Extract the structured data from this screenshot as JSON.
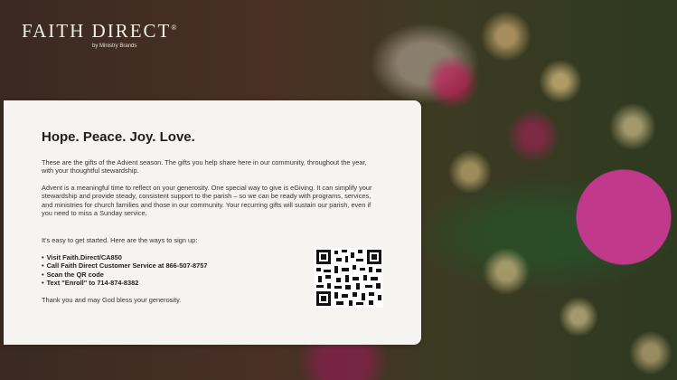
{
  "brand": {
    "name": "FAITH DIRECT",
    "mark": "®",
    "tagline": "by Ministry Brands"
  },
  "card": {
    "title": "Hope. Peace. Joy. Love.",
    "paragraph_1": "These are the gifts of the Advent season. The gifts you help share here in our community, throughout the year, with your thoughtful stewardship.",
    "paragraph_2": "Advent is a meaningful time to reflect on your generosity. One special way to give is eGiving. It can simplify your stewardship and provide steady, consistent support to the parish – so we can be ready with programs, services, and ministries for church families and those in our community. Your recurring gifts will sustain our parish, even if you need to miss a Sunday service.",
    "intro": "It's easy to get started. Here are the ways to sign up:",
    "ways": [
      "Visit Faith.Direct/CA850",
      "Call Faith Direct Customer Service at 866-507-8757",
      "Scan the QR code",
      "Text \"Enroll\" to  714-874-8382"
    ],
    "closing": "Thank you and may God bless your generosity."
  },
  "colors": {
    "card_background": "#f6f4f1",
    "ornament": "#c0398a",
    "brand_text": "#f2efe8"
  }
}
